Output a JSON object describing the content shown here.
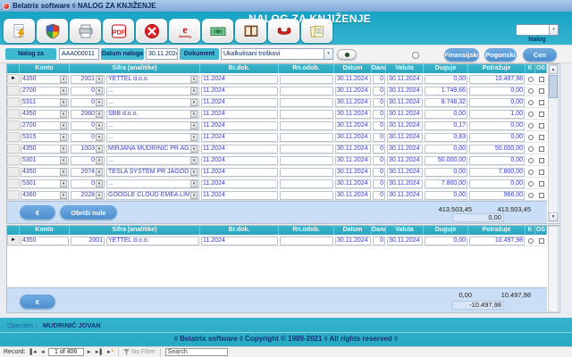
{
  "window_title": "Belatrix software ◊ NALOG ZA KNJIŽENJE",
  "header": {
    "title": "NALOG ZA KNJIŽENJE",
    "nalog_label": "Nalog",
    "nalog_value": ""
  },
  "toolbar": {
    "icons": [
      "new-document",
      "security-shield",
      "printer",
      "pdf",
      "close",
      "e-banking",
      "cash",
      "ledger-book",
      "phone",
      "invoices"
    ]
  },
  "form": {
    "nalog_label": "Nalog za knjiženje",
    "nalog_value": "AAA000011",
    "datum_label": "Datum naloga",
    "datum_value": "30.11.2024",
    "dokument_label": "Dokument",
    "dokument_value": "Ukalkulisani troškovi",
    "btn_finansijski": "Finansijski",
    "btn_pogonski": "Pogonski",
    "btn_cen": "Cen"
  },
  "columns": {
    "konto": "Konto",
    "sifra": "Šifra (analitike)",
    "brdok": "Br.dok.",
    "rnodob": "Rn.odob.",
    "datum": "Datum",
    "dana": "Dana",
    "valuta": "Valuta",
    "duguje": "Duguje",
    "potrazuje": "Potražuje",
    "k": "K",
    "os": "OS"
  },
  "grid1": {
    "rows": [
      {
        "konto": "4350",
        "sifra": "2001",
        "naziv": "YETTEL d.o.o.",
        "brdok": "11.2024",
        "rnodob": "",
        "datum": "30.11.2024",
        "dana": "0",
        "valuta": "30.11.2024",
        "duguje": "0,00",
        "potrazuje": "10.497,98"
      },
      {
        "konto": "2700",
        "sifra": "0",
        "naziv": "...",
        "brdok": "11.2024",
        "rnodob": "",
        "datum": "30.11.2024",
        "dana": "0",
        "valuta": "30.11.2024",
        "duguje": "1.749,66",
        "potrazuje": "0,00"
      },
      {
        "konto": "5311",
        "sifra": "0",
        "naziv": "...",
        "brdok": "11.2024",
        "rnodob": "",
        "datum": "30.11.2024",
        "dana": "0",
        "valuta": "30.11.2024",
        "duguje": "8.748,32",
        "potrazuje": "0,00"
      },
      {
        "konto": "4350",
        "sifra": "2060",
        "naziv": "SBB d.o.o.",
        "brdok": "11.2024",
        "rnodob": "",
        "datum": "30.11.2024",
        "dana": "0",
        "valuta": "30.11.2024",
        "duguje": "0,00",
        "potrazuje": "1,00"
      },
      {
        "konto": "2700",
        "sifra": "0",
        "naziv": "...",
        "brdok": "11.2024",
        "rnodob": "",
        "datum": "30.11.2024",
        "dana": "0",
        "valuta": "30.11.2024",
        "duguje": "0,17",
        "potrazuje": "0,00"
      },
      {
        "konto": "5315",
        "sifra": "0",
        "naziv": "...",
        "brdok": "11.2024",
        "rnodob": "",
        "datum": "30.11.2024",
        "dana": "0",
        "valuta": "30.11.2024",
        "duguje": "0,83",
        "potrazuje": "0,00"
      },
      {
        "konto": "4350",
        "sifra": "1003",
        "naziv": "MIRJANA MUDRINIĆ PR AGENCIJA ZA RAČ",
        "brdok": "11.2024",
        "rnodob": "",
        "datum": "30.11.2024",
        "dana": "0",
        "valuta": "30.11.2024",
        "duguje": "0,00",
        "potrazuje": "50.000,00"
      },
      {
        "konto": "5301",
        "sifra": "0",
        "naziv": "...",
        "brdok": "11.2024",
        "rnodob": "",
        "datum": "30.11.2024",
        "dana": "0",
        "valuta": "30.11.2024",
        "duguje": "50.000,00",
        "potrazuje": "0,00"
      },
      {
        "konto": "4350",
        "sifra": "2074",
        "naziv": "TESLA SYSTEM PR JAGODINA",
        "brdok": "11.2024",
        "rnodob": "",
        "datum": "30.11.2024",
        "dana": "0",
        "valuta": "30.11.2024",
        "duguje": "0,00",
        "potrazuje": "7.800,00"
      },
      {
        "konto": "5301",
        "sifra": "0",
        "naziv": "...",
        "brdok": "11.2024",
        "rnodob": "",
        "datum": "30.11.2024",
        "dana": "0",
        "valuta": "30.11.2024",
        "duguje": "7.800,00",
        "potrazuje": "0,00"
      },
      {
        "konto": "4360",
        "sifra": "2028",
        "naziv": "GOOGLE CLOUD EMEA LIMITED",
        "brdok": "11.2024",
        "rnodob": "",
        "datum": "30.11.2024",
        "dana": "0",
        "valuta": "30.11.2024",
        "duguje": "0,00",
        "potrazuje": "966,00"
      }
    ],
    "totals": {
      "duguje": "413.503,45",
      "potrazuje": "413.503,45",
      "saldo": "0,00"
    },
    "euro_label": "€",
    "obrisi_label": "Obriši nule"
  },
  "grid2": {
    "rows": [
      {
        "konto": "4350",
        "sifra": "2001",
        "naziv": "YETTEL d.o.o.",
        "brdok": "11.2024",
        "rnodob": "",
        "datum": "30.11.2024",
        "dana": "0",
        "valuta": "30.11.2024",
        "duguje": "0,00",
        "potrazuje": "10.497,98"
      }
    ],
    "totals": {
      "duguje": "0,00",
      "potrazuje": "10.497,98",
      "saldo": "-10.497,98"
    },
    "euro_label": "€"
  },
  "statusbar": {
    "operator_label": "Operater :",
    "operator_name": "MUDRINIĆ JOVAN"
  },
  "footer_text": "◊ Belatrix software ◊ Copyright © 1989-2021 ◊ All rights reserved ◊",
  "recordnav": {
    "label": "Record:",
    "position": "1 of 406",
    "no_filter": "No Filter",
    "search": "Search"
  },
  "colors": {
    "teal_accent": "#2bafc9",
    "button_blue": "#5b9bd5",
    "totals_bg": "#cadef5",
    "value_text": "#3a3ac8"
  }
}
